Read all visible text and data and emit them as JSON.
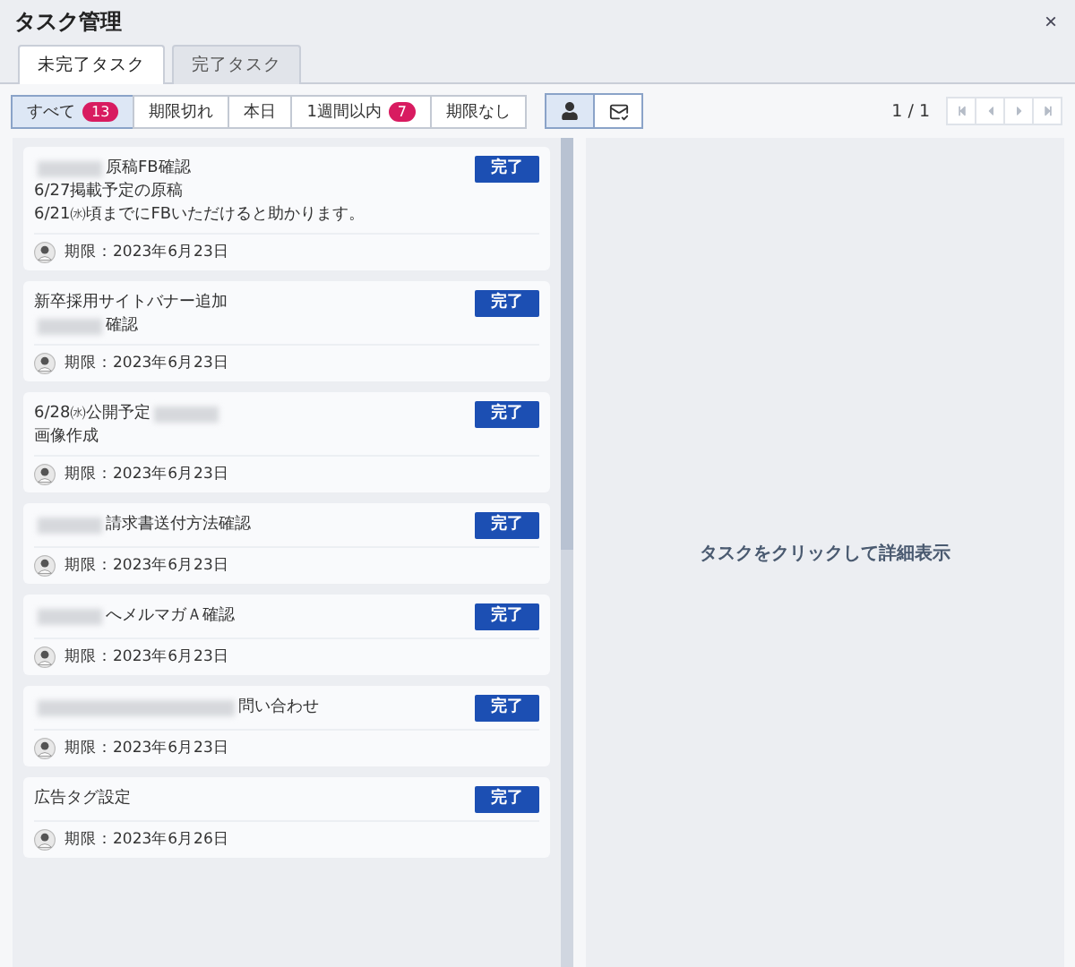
{
  "window": {
    "title": "タスク管理",
    "close": "×"
  },
  "tabs": [
    {
      "label": "未完了タスク",
      "selected": true
    },
    {
      "label": "完了タスク",
      "selected": false
    }
  ],
  "filters": [
    {
      "label": "すべて",
      "badge": "13",
      "selected": true
    },
    {
      "label": "期限切れ",
      "selected": false
    },
    {
      "label": "本日",
      "selected": false
    },
    {
      "label": "1週間以内",
      "badge": "7",
      "selected": false
    },
    {
      "label": "期限なし",
      "selected": false
    }
  ],
  "view_toggles": [
    {
      "kind": "person",
      "selected": true
    },
    {
      "kind": "export",
      "selected": false
    }
  ],
  "pagination": {
    "label": "1 / 1",
    "buttons": [
      {
        "kind": "first",
        "disabled": true
      },
      {
        "kind": "prev",
        "disabled": true
      },
      {
        "kind": "next",
        "disabled": true
      },
      {
        "kind": "last",
        "disabled": true
      }
    ]
  },
  "tasks": [
    {
      "lines": [
        [
          {
            "kind": "redacted"
          },
          {
            "kind": "text",
            "text": "原稿FB確認"
          }
        ],
        [
          {
            "kind": "text",
            "text": "6/27掲載予定の原稿"
          }
        ],
        [
          {
            "kind": "text",
            "text": "6/21㈬頃までにFBいただけると助かります。"
          }
        ]
      ],
      "button": "完了",
      "due": "期限：2023年6月23日"
    },
    {
      "lines": [
        [
          {
            "kind": "text",
            "text": "新卒採用サイトバナー追加"
          }
        ],
        [
          {
            "kind": "redacted"
          },
          {
            "kind": "text",
            "text": "確認"
          }
        ]
      ],
      "button": "完了",
      "due": "期限：2023年6月23日"
    },
    {
      "lines": [
        [
          {
            "kind": "text",
            "text": "6/28㈬公開予定"
          },
          {
            "kind": "redacted"
          }
        ],
        [
          {
            "kind": "text",
            "text": "画像作成"
          }
        ]
      ],
      "button": "完了",
      "due": "期限：2023年6月23日"
    },
    {
      "lines": [
        [
          {
            "kind": "redacted"
          },
          {
            "kind": "text",
            "text": "請求書送付方法確認"
          }
        ]
      ],
      "button": "完了",
      "due": "期限：2023年6月23日"
    },
    {
      "lines": [
        [
          {
            "kind": "redacted"
          },
          {
            "kind": "text",
            "text": "へメルマガＡ確認"
          }
        ]
      ],
      "button": "完了",
      "due": "期限：2023年6月23日"
    },
    {
      "lines": [
        [
          {
            "kind": "redacted",
            "wide": true
          },
          {
            "kind": "text",
            "text": "問い合わせ"
          }
        ]
      ],
      "button": "完了",
      "due": "期限：2023年6月23日"
    },
    {
      "lines": [
        [
          {
            "kind": "text",
            "text": "広告タグ設定"
          }
        ]
      ],
      "button": "完了",
      "due": "期限：2023年6月26日"
    }
  ],
  "detail": {
    "message": "タスクをクリックして詳細表示"
  }
}
